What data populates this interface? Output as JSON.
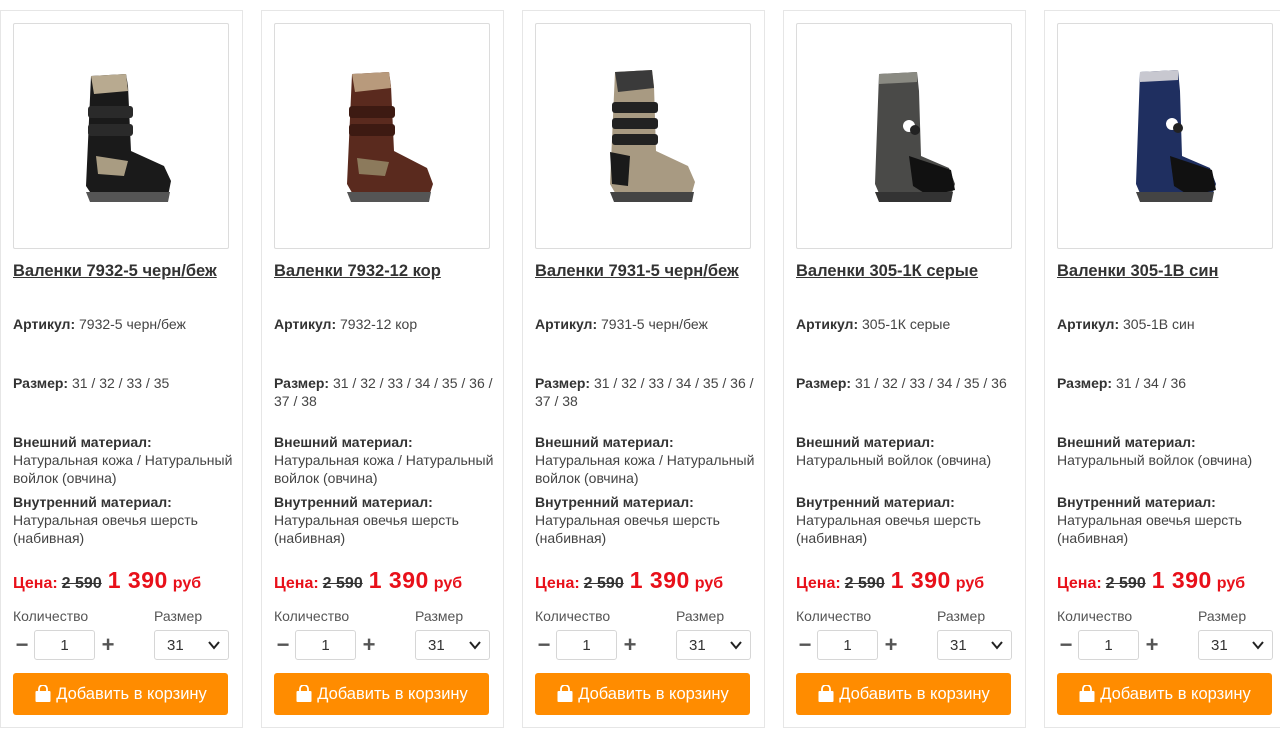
{
  "labels": {
    "article": "Артикул:",
    "size": "Размер:",
    "outer": "Внешний материал:",
    "inner": "Внутренний материал:",
    "price": "Цена:",
    "currency": "руб",
    "quantity": "Количество",
    "size_select": "Размер",
    "add_to_cart": "Добавить в корзину"
  },
  "colors": {
    "accent": "#ff8c00",
    "price_red": "#e8101a"
  },
  "products": [
    {
      "title": "Валенки 7932-5 черн/беж",
      "article": "7932-5 черн/беж",
      "sizes": "31 / 32 / 33 / 35",
      "outer": "Натуральная кожа / Натуральный войлок (овчина)",
      "inner": "Натуральная овечья шерсть (набивная)",
      "old_price": "2 590",
      "new_price": "1 390",
      "qty": "1",
      "size_selected": "31",
      "image": "black-beige-velcro-boot"
    },
    {
      "title": "Валенки 7932-12 кор",
      "article": "7932-12 кор",
      "sizes": "31 / 32 / 33 / 34 / 35 / 36 / 37 / 38",
      "outer": "Натуральная кожа / Натуральный войлок (овчина)",
      "inner": "Натуральная овечья шерсть (набивная)",
      "old_price": "2 590",
      "new_price": "1 390",
      "qty": "1",
      "size_selected": "31",
      "image": "brown-velcro-boot"
    },
    {
      "title": "Валенки 7931-5 черн/беж",
      "article": "7931-5 черн/беж",
      "sizes": "31 / 32 / 33 / 34 / 35 / 36 / 37 / 38",
      "outer": "Натуральная кожа / Натуральный войлок (овчина)",
      "inner": "Натуральная овечья шерсть (набивная)",
      "old_price": "2 590",
      "new_price": "1 390",
      "qty": "1",
      "size_selected": "31",
      "image": "grey-beige-velcro-boot"
    },
    {
      "title": "Валенки 305-1К серые",
      "article": "305-1К серые",
      "sizes": "31 / 32 / 33 / 34 / 35 / 36",
      "outer": "Натуральный войлок (овчина)",
      "inner": "Натуральная овечья шерсть (набивная)",
      "old_price": "2 590",
      "new_price": "1 390",
      "qty": "1",
      "size_selected": "31",
      "image": "grey-felt-boot"
    },
    {
      "title": "Валенки 305-1В син",
      "article": "305-1В син",
      "sizes": "31 / 34 / 36",
      "outer": "Натуральный войлок (овчина)",
      "inner": "Натуральная овечья шерсть (набивная)",
      "old_price": "2 590",
      "new_price": "1 390",
      "qty": "1",
      "size_selected": "31",
      "image": "blue-felt-boot"
    }
  ]
}
